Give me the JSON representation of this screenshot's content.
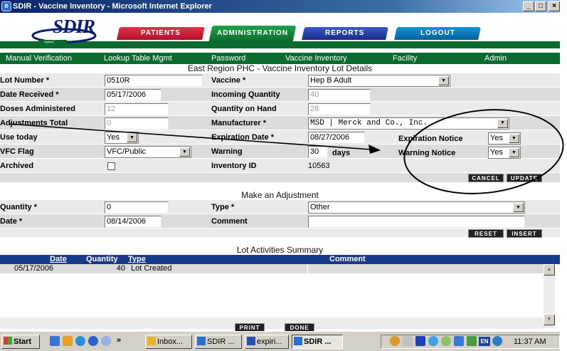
{
  "window": {
    "title": "SDIR - Vaccine Inventory - Microsoft Internet Explorer",
    "controls": [
      "_",
      "□",
      "×"
    ]
  },
  "header": {
    "logo_text": "SDIR",
    "logo_sub": "san diego immunization registry",
    "tabs": [
      {
        "label": "PATIENTS",
        "color": "#c8102e"
      },
      {
        "label": "ADMINISTRATION",
        "color": "#0b6b2f"
      },
      {
        "label": "REPORTS",
        "color": "#1a2a88"
      },
      {
        "label": "LOGOUT",
        "color": "#0a6fb0"
      }
    ]
  },
  "subnav": [
    "Manual Verification",
    "Lookup Table Mgmt",
    "Password",
    "Vaccine Inventory",
    "Facility",
    "Admin"
  ],
  "page_title": "East Region PHC - Vaccine Inventory Lot Details",
  "lot": {
    "lot_number_label": "Lot Number *",
    "lot_number": "0510R",
    "date_received_label": "Date Received *",
    "date_received": "05/17/2006",
    "doses_label": "Doses Administered",
    "doses": "12",
    "adjustments_label": "Adjustments Total",
    "adjustments": "0",
    "use_today_label": "Use today",
    "use_today": "Yes",
    "vfc_label": "VFC Flag",
    "vfc": "VFC/Public",
    "archived_label": "Archived",
    "vaccine_label": "Vaccine *",
    "vaccine": "Hep B Adult",
    "incoming_label": "Incoming Quantity",
    "incoming": "40",
    "on_hand_label": "Quantity on Hand",
    "on_hand": "28",
    "manufacturer_label": "Manufacturer *",
    "manufacturer": "MSD | Merck and Co., Inc.",
    "expiration_label": "Expiration Date *",
    "expiration": "08/27/2006",
    "warning_label": "Warning",
    "warning": "30",
    "warning_unit": "days",
    "inventory_id_label": "Inventory ID",
    "inventory_id": "10563",
    "exp_notice_label": "Expiration Notice",
    "exp_notice": "Yes",
    "warn_notice_label": "Warning Notice",
    "warn_notice": "Yes",
    "cancel_label": "CANCEL",
    "update_label": "UPDATE"
  },
  "adjust": {
    "title": "Make an Adjustment",
    "quantity_label": "Quantity *",
    "quantity": "0",
    "type_label": "Type *",
    "type": "Other",
    "date_label": "Date *",
    "date": "08/14/2006",
    "comment_label": "Comment",
    "comment": "",
    "reset_label": "RESET",
    "insert_label": "INSERT"
  },
  "summary": {
    "title": "Lot Activities Summary",
    "columns": [
      "Date",
      "Quantity",
      "Type",
      "Comment"
    ],
    "rows": [
      {
        "date": "05/17/2006",
        "quantity": "40",
        "type": "Lot Created",
        "comment": ""
      }
    ],
    "print_label": "PRINT",
    "done_label": "DONE"
  },
  "taskbar": {
    "start": "Start",
    "quick_more": "»",
    "items": [
      "Inbox...",
      "SDIR ...",
      "expiri...",
      "SDIR ..."
    ],
    "tray_lang": "EN",
    "clock": "11:37 AM"
  }
}
